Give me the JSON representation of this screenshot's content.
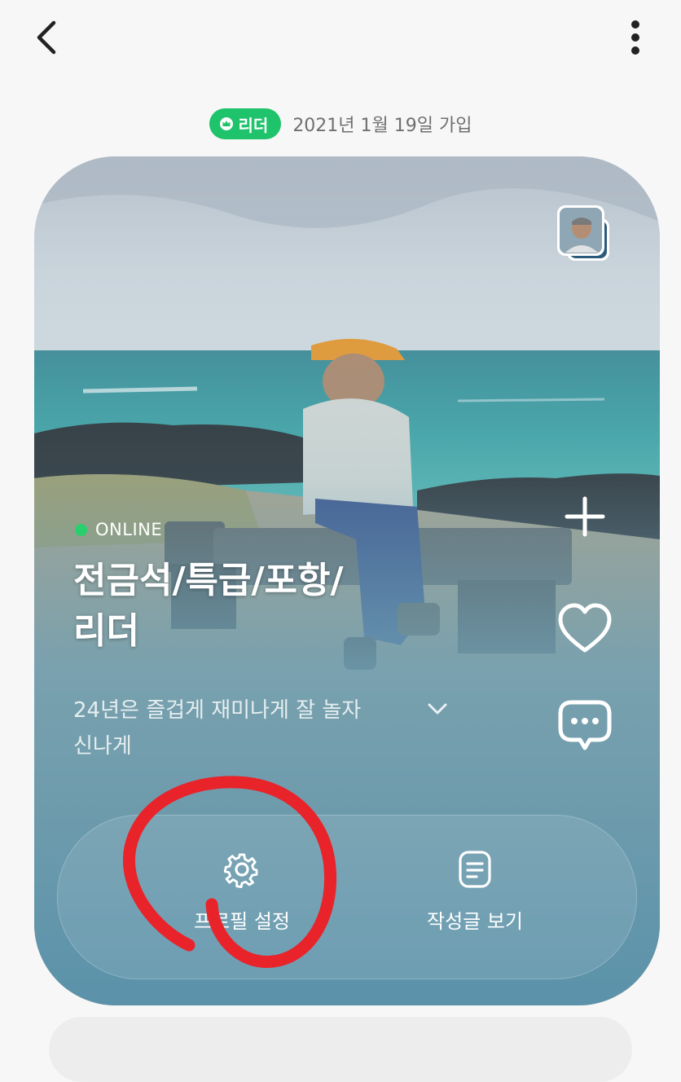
{
  "topbar": {
    "back_icon": "chevron-left-icon",
    "more_icon": "vertical-dots-icon"
  },
  "profile_meta": {
    "badge_icon": "crown-icon",
    "badge_label": "리더",
    "joined": "2021년 1월 19일 가입",
    "badge_color": "#1ec36b"
  },
  "profile": {
    "online_label": "ONLINE",
    "name_line1": "전금석/특급/포항/",
    "name_line2": "리더",
    "status_line1": "24년은 즐겁게 재미나게 잘 놀자",
    "status_line2": "신나게"
  },
  "side_actions": [
    {
      "icon": "plus-icon"
    },
    {
      "icon": "heart-icon"
    },
    {
      "icon": "chat-bubble-icon"
    }
  ],
  "actions": {
    "settings_label": "프로필 설정",
    "posts_label": "작성글 보기"
  },
  "colors": {
    "online_dot": "#27d06d",
    "annotation": "#e8232a"
  }
}
